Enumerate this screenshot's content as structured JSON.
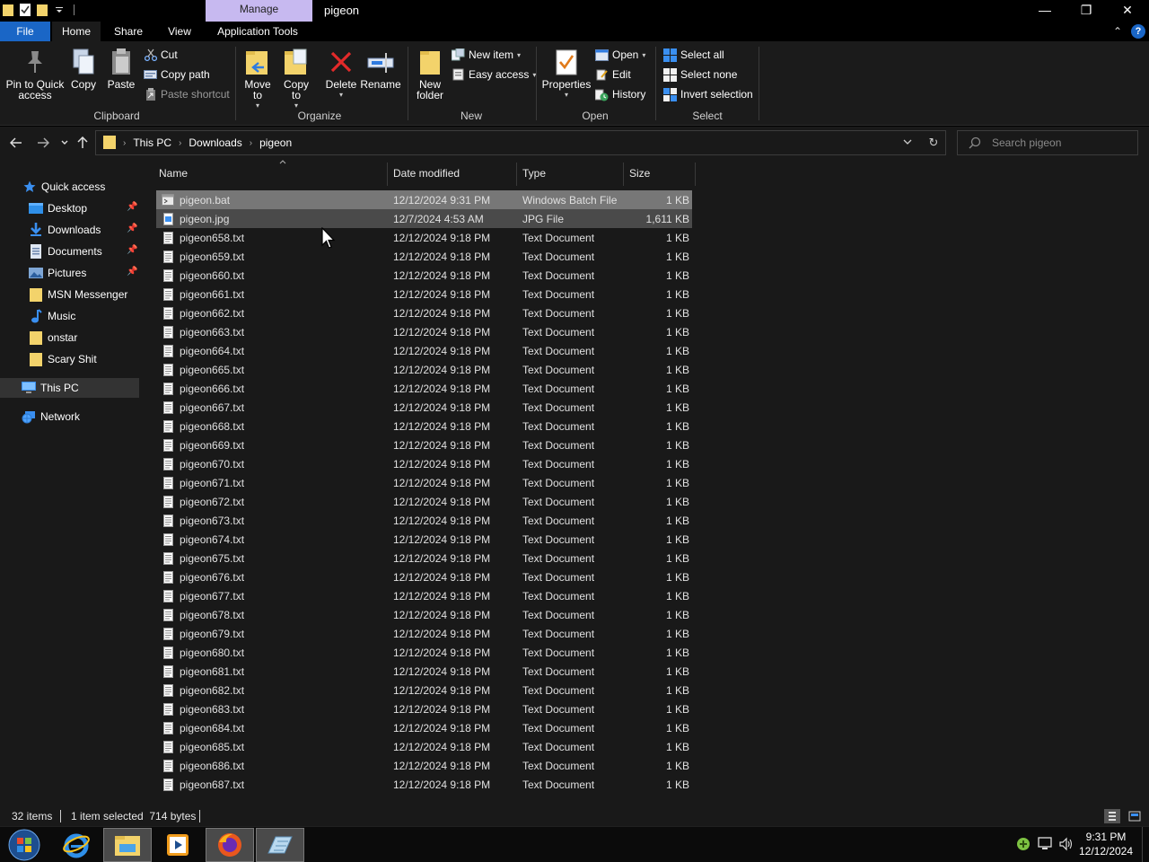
{
  "window": {
    "title": "pigeon",
    "contextual_tab": "Manage",
    "controls": {
      "minimize": "—",
      "maximize": "❐",
      "close": "✕"
    }
  },
  "ribbon_tabs": [
    "File",
    "Home",
    "Share",
    "View",
    "Application Tools"
  ],
  "ribbon": {
    "clipboard": {
      "label": "Clipboard",
      "pin_to_quick_access": "Pin to Quick access",
      "copy": "Copy",
      "paste": "Paste",
      "cut": "Cut",
      "copy_path": "Copy path",
      "paste_shortcut": "Paste shortcut"
    },
    "organize": {
      "label": "Organize",
      "move_to": "Move to",
      "copy_to": "Copy to",
      "delete": "Delete",
      "rename": "Rename"
    },
    "new": {
      "label": "New",
      "new_folder": "New folder",
      "new_item": "New item",
      "easy_access": "Easy access"
    },
    "open": {
      "label": "Open",
      "properties": "Properties",
      "open": "Open",
      "edit": "Edit",
      "history": "History"
    },
    "select": {
      "label": "Select",
      "select_all": "Select all",
      "select_none": "Select none",
      "invert_selection": "Invert selection"
    }
  },
  "address": {
    "breadcrumbs": [
      "This PC",
      "Downloads",
      "pigeon"
    ]
  },
  "search": {
    "placeholder": "Search pigeon"
  },
  "nav_pane": {
    "quick_access": "Quick access",
    "items": [
      {
        "label": "Desktop",
        "pinned": true
      },
      {
        "label": "Downloads",
        "pinned": true
      },
      {
        "label": "Documents",
        "pinned": true
      },
      {
        "label": "Pictures",
        "pinned": true
      },
      {
        "label": "MSN Messenger",
        "pinned": false
      },
      {
        "label": "Music",
        "pinned": false
      },
      {
        "label": "onstar",
        "pinned": false
      },
      {
        "label": "Scary Shit",
        "pinned": false
      }
    ],
    "this_pc": "This PC",
    "network": "Network"
  },
  "columns": [
    "Name",
    "Date modified",
    "Type",
    "Size"
  ],
  "files": [
    {
      "name": "pigeon.bat",
      "date": "12/12/2024 9:31 PM",
      "type": "Windows Batch File",
      "size": "1 KB",
      "icon": "bat",
      "state": "selected"
    },
    {
      "name": "pigeon.jpg",
      "date": "12/7/2024 4:53 AM",
      "type": "JPG File",
      "size": "1,611 KB",
      "icon": "jpg",
      "state": "hover"
    },
    {
      "name": "pigeon658.txt",
      "date": "12/12/2024 9:18 PM",
      "type": "Text Document",
      "size": "1 KB",
      "icon": "txt"
    },
    {
      "name": "pigeon659.txt",
      "date": "12/12/2024 9:18 PM",
      "type": "Text Document",
      "size": "1 KB",
      "icon": "txt"
    },
    {
      "name": "pigeon660.txt",
      "date": "12/12/2024 9:18 PM",
      "type": "Text Document",
      "size": "1 KB",
      "icon": "txt"
    },
    {
      "name": "pigeon661.txt",
      "date": "12/12/2024 9:18 PM",
      "type": "Text Document",
      "size": "1 KB",
      "icon": "txt"
    },
    {
      "name": "pigeon662.txt",
      "date": "12/12/2024 9:18 PM",
      "type": "Text Document",
      "size": "1 KB",
      "icon": "txt"
    },
    {
      "name": "pigeon663.txt",
      "date": "12/12/2024 9:18 PM",
      "type": "Text Document",
      "size": "1 KB",
      "icon": "txt"
    },
    {
      "name": "pigeon664.txt",
      "date": "12/12/2024 9:18 PM",
      "type": "Text Document",
      "size": "1 KB",
      "icon": "txt"
    },
    {
      "name": "pigeon665.txt",
      "date": "12/12/2024 9:18 PM",
      "type": "Text Document",
      "size": "1 KB",
      "icon": "txt"
    },
    {
      "name": "pigeon666.txt",
      "date": "12/12/2024 9:18 PM",
      "type": "Text Document",
      "size": "1 KB",
      "icon": "txt"
    },
    {
      "name": "pigeon667.txt",
      "date": "12/12/2024 9:18 PM",
      "type": "Text Document",
      "size": "1 KB",
      "icon": "txt"
    },
    {
      "name": "pigeon668.txt",
      "date": "12/12/2024 9:18 PM",
      "type": "Text Document",
      "size": "1 KB",
      "icon": "txt"
    },
    {
      "name": "pigeon669.txt",
      "date": "12/12/2024 9:18 PM",
      "type": "Text Document",
      "size": "1 KB",
      "icon": "txt"
    },
    {
      "name": "pigeon670.txt",
      "date": "12/12/2024 9:18 PM",
      "type": "Text Document",
      "size": "1 KB",
      "icon": "txt"
    },
    {
      "name": "pigeon671.txt",
      "date": "12/12/2024 9:18 PM",
      "type": "Text Document",
      "size": "1 KB",
      "icon": "txt"
    },
    {
      "name": "pigeon672.txt",
      "date": "12/12/2024 9:18 PM",
      "type": "Text Document",
      "size": "1 KB",
      "icon": "txt"
    },
    {
      "name": "pigeon673.txt",
      "date": "12/12/2024 9:18 PM",
      "type": "Text Document",
      "size": "1 KB",
      "icon": "txt"
    },
    {
      "name": "pigeon674.txt",
      "date": "12/12/2024 9:18 PM",
      "type": "Text Document",
      "size": "1 KB",
      "icon": "txt"
    },
    {
      "name": "pigeon675.txt",
      "date": "12/12/2024 9:18 PM",
      "type": "Text Document",
      "size": "1 KB",
      "icon": "txt"
    },
    {
      "name": "pigeon676.txt",
      "date": "12/12/2024 9:18 PM",
      "type": "Text Document",
      "size": "1 KB",
      "icon": "txt"
    },
    {
      "name": "pigeon677.txt",
      "date": "12/12/2024 9:18 PM",
      "type": "Text Document",
      "size": "1 KB",
      "icon": "txt"
    },
    {
      "name": "pigeon678.txt",
      "date": "12/12/2024 9:18 PM",
      "type": "Text Document",
      "size": "1 KB",
      "icon": "txt"
    },
    {
      "name": "pigeon679.txt",
      "date": "12/12/2024 9:18 PM",
      "type": "Text Document",
      "size": "1 KB",
      "icon": "txt"
    },
    {
      "name": "pigeon680.txt",
      "date": "12/12/2024 9:18 PM",
      "type": "Text Document",
      "size": "1 KB",
      "icon": "txt"
    },
    {
      "name": "pigeon681.txt",
      "date": "12/12/2024 9:18 PM",
      "type": "Text Document",
      "size": "1 KB",
      "icon": "txt"
    },
    {
      "name": "pigeon682.txt",
      "date": "12/12/2024 9:18 PM",
      "type": "Text Document",
      "size": "1 KB",
      "icon": "txt"
    },
    {
      "name": "pigeon683.txt",
      "date": "12/12/2024 9:18 PM",
      "type": "Text Document",
      "size": "1 KB",
      "icon": "txt"
    },
    {
      "name": "pigeon684.txt",
      "date": "12/12/2024 9:18 PM",
      "type": "Text Document",
      "size": "1 KB",
      "icon": "txt"
    },
    {
      "name": "pigeon685.txt",
      "date": "12/12/2024 9:18 PM",
      "type": "Text Document",
      "size": "1 KB",
      "icon": "txt"
    },
    {
      "name": "pigeon686.txt",
      "date": "12/12/2024 9:18 PM",
      "type": "Text Document",
      "size": "1 KB",
      "icon": "txt"
    },
    {
      "name": "pigeon687.txt",
      "date": "12/12/2024 9:18 PM",
      "type": "Text Document",
      "size": "1 KB",
      "icon": "txt"
    }
  ],
  "status": {
    "item_count": "32 items",
    "selection": "1 item selected  714 bytes"
  },
  "taskbar": {
    "apps": [
      "start-orb-icon",
      "internet-explorer-icon",
      "file-explorer-icon",
      "media-player-icon",
      "firefox-icon",
      "notepad-icon"
    ],
    "clock_time": "9:31 PM",
    "clock_date": "12/12/2024"
  },
  "colors": {
    "accent": "#1a66c6",
    "manage_tab": "#c7b9f0",
    "selected_row": "#777777",
    "hover_row": "#4a4a4a",
    "folder": "#f3d36b"
  }
}
